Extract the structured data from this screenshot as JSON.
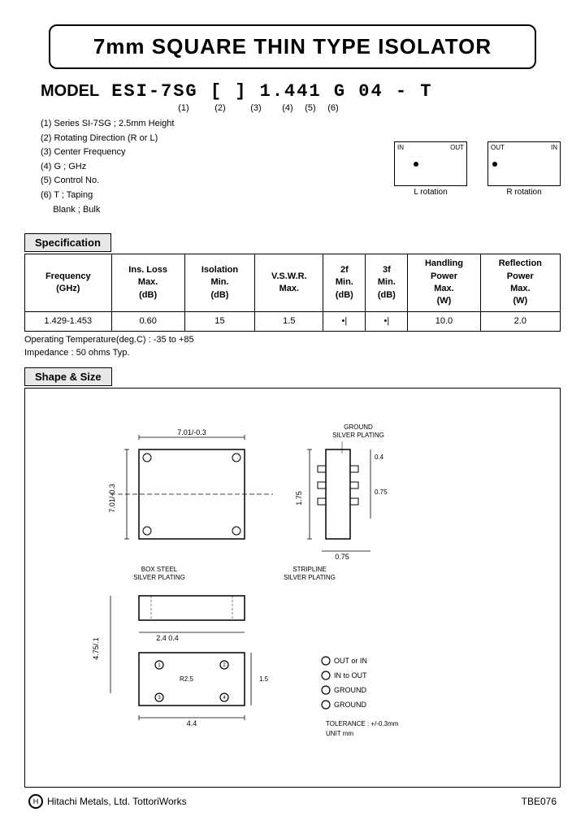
{
  "title": "7mm SQUARE THIN TYPE ISOLATOR",
  "model": {
    "label": "MODEL",
    "value": "ESI-7SG [ ] 1.441 G 04 - T",
    "numbers": [
      "(1)",
      "(2)",
      "(3)",
      "(4)",
      "(5)",
      "(6)"
    ],
    "descriptions": [
      "(1) Series  SI-7SG ; 2.5mm Height",
      "(2) Rotating Direction (R or L)",
      "(3) Center Frequency",
      "(4) G ; GHz",
      "(5) Control No.",
      "(6) T ; Taping",
      "      Blank ; Bulk"
    ]
  },
  "spec_header": "Specification",
  "table": {
    "headers": [
      "Frequency\n(GHz)",
      "Ins. Loss\nMax.\n(dB)",
      "Isolation\nMin.\n(dB)",
      "V.S.W.R.\nMax.",
      "2f\nMin.\n(dB)",
      "3f\nMin.\n(dB)",
      "Handling\nPower\nMax.\n(W)",
      "Reflection\nPower\nMax.\n(W)"
    ],
    "row": {
      "frequency": "1.429-1.453",
      "ins_loss": "0.60",
      "isolation": "15",
      "vswr": "1.5",
      "twof": "•|",
      "threef": "•|",
      "handling": "10.0",
      "reflection": "2.0"
    }
  },
  "operating_temp": "Operating Temperature(deg.C) : -35 to +85",
  "impedance": "Impedance : 50 ohms Typ.",
  "shape_header": "Shape & Size",
  "footer": {
    "company": "Hitachi Metals, Ltd. TottoriWorks",
    "code": "TBE076"
  }
}
